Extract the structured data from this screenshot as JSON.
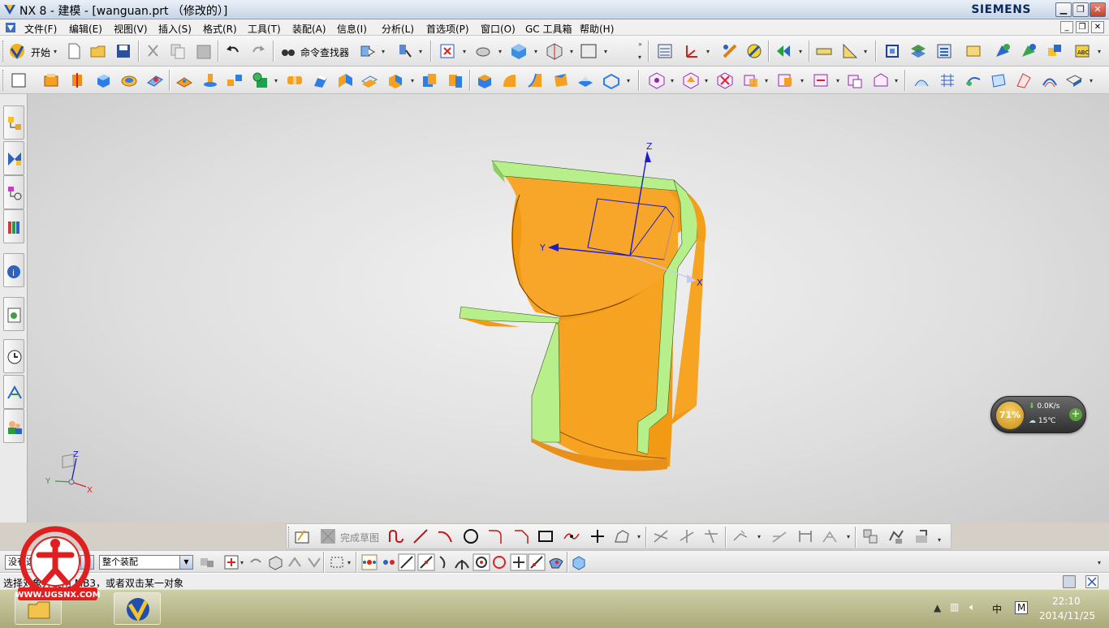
{
  "window": {
    "title": "NX 8 - 建模 - [wanguan.prt （修改的）]",
    "brand": "SIEMENS",
    "minimize_label": "▁",
    "restore_label": "❐",
    "close_label": "✕"
  },
  "menubar": {
    "items": [
      "文件(F)",
      "编辑(E)",
      "视图(V)",
      "插入(S)",
      "格式(R)",
      "工具(T)",
      "装配(A)",
      "信息(I)",
      "分析(L)",
      "首选项(P)",
      "窗口(O)",
      "GC 工具箱",
      "帮助(H)"
    ]
  },
  "toolbar": {
    "start_label": "开始",
    "command_finder_label": "命令查找器"
  },
  "viewport": {
    "axis_z": "Z",
    "axis_y": "Y",
    "axis_x": "X",
    "triad_z": "Z",
    "triad_y": "Y",
    "triad_x": "X",
    "accent_color": "#f5a00f",
    "face_green": "#b7f08a"
  },
  "net_widget": {
    "cpu_percent": "71%",
    "speed": "0.0K/s",
    "temperature": "15℃",
    "plus_label": "+"
  },
  "sketch_toolbar": {
    "finish_sketch_label": "完成草图"
  },
  "selection_bar": {
    "filter_value": "没有选择过滤器",
    "scope_value": "整个装配"
  },
  "statusbar": {
    "prompt": "选择对象并使用 MB3，或者双击某一对象"
  },
  "taskbar": {
    "ime_label": "中",
    "ime_mode": "M",
    "time": "22:10",
    "date": "2014/11/25"
  },
  "watermark": {
    "url": "WWW.UGSNX.COM"
  }
}
